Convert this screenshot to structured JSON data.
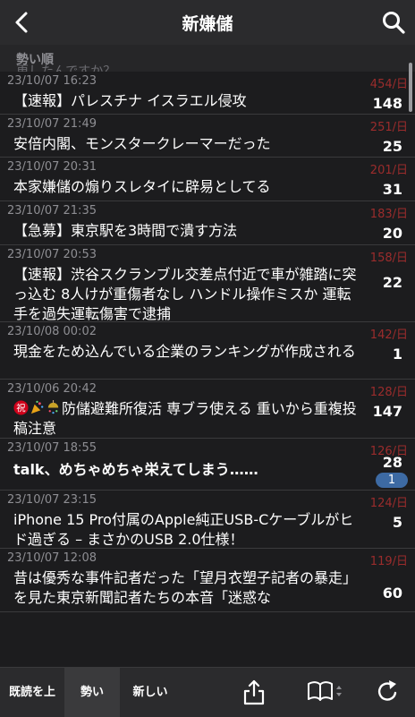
{
  "header": {
    "title": "新嫌儲"
  },
  "sort_bar": {
    "label": "勢い順",
    "overflow_text": "更したんですか？"
  },
  "threads": [
    {
      "date": "23/10/07 16:23",
      "rate": "454/日",
      "title": "【速報】パレスチナ イスラエル侵攻",
      "count": "148"
    },
    {
      "date": "23/10/07 21:49",
      "rate": "251/日",
      "title": "安倍内閣、モンスタークレーマーだった",
      "count": "25"
    },
    {
      "date": "23/10/07 20:31",
      "rate": "201/日",
      "title": "本家嫌儲の煽りスレタイに辟易としてる",
      "count": "31"
    },
    {
      "date": "23/10/07 21:35",
      "rate": "183/日",
      "title": "【急募】東京駅を3時間で潰す方法",
      "count": "20"
    },
    {
      "date": "23/10/07 20:53",
      "rate": "158/日",
      "title": "【速報】渋谷スクランブル交差点付近で車が雑踏に突っ込む 8人けが重傷者なし ハンドル操作ミスか 運転手を過失運転傷害で逮捕",
      "count": "22"
    },
    {
      "date": "23/10/08 00:02",
      "rate": "142/日",
      "title": "現金をため込んでいる企業のランキングが作成される",
      "count": "1"
    },
    {
      "date": "23/10/06 20:42",
      "rate": "128/日",
      "title": "防儲避難所復活 専ブラ使える 重いから重複投稿注意",
      "count": "147",
      "emoji": [
        "celebration-kanji-icon",
        "party-popper-icon",
        "confetti-ball-icon"
      ]
    },
    {
      "date": "23/10/07 18:55",
      "rate": "126/日",
      "title": "talk、めちゃめちゃ栄えてしまう……",
      "count": "28",
      "new": "1"
    },
    {
      "date": "23/10/07 23:15",
      "rate": "124/日",
      "title": "iPhone 15 Pro付属のApple純正USB-Cケーブルがヒド過ぎる – まさかのUSB 2.0仕様！",
      "count": "5"
    },
    {
      "date": "23/10/07 12:08",
      "rate": "119/日",
      "title": "昔は優秀な事件記者だった「望月衣塑子記者の暴走」を見た東京新聞記者たちの本音「迷惑な",
      "count": "60"
    }
  ],
  "footer": {
    "tabs": [
      {
        "label": "既読を上"
      },
      {
        "label": "勢い"
      },
      {
        "label": "新しい"
      }
    ]
  }
}
